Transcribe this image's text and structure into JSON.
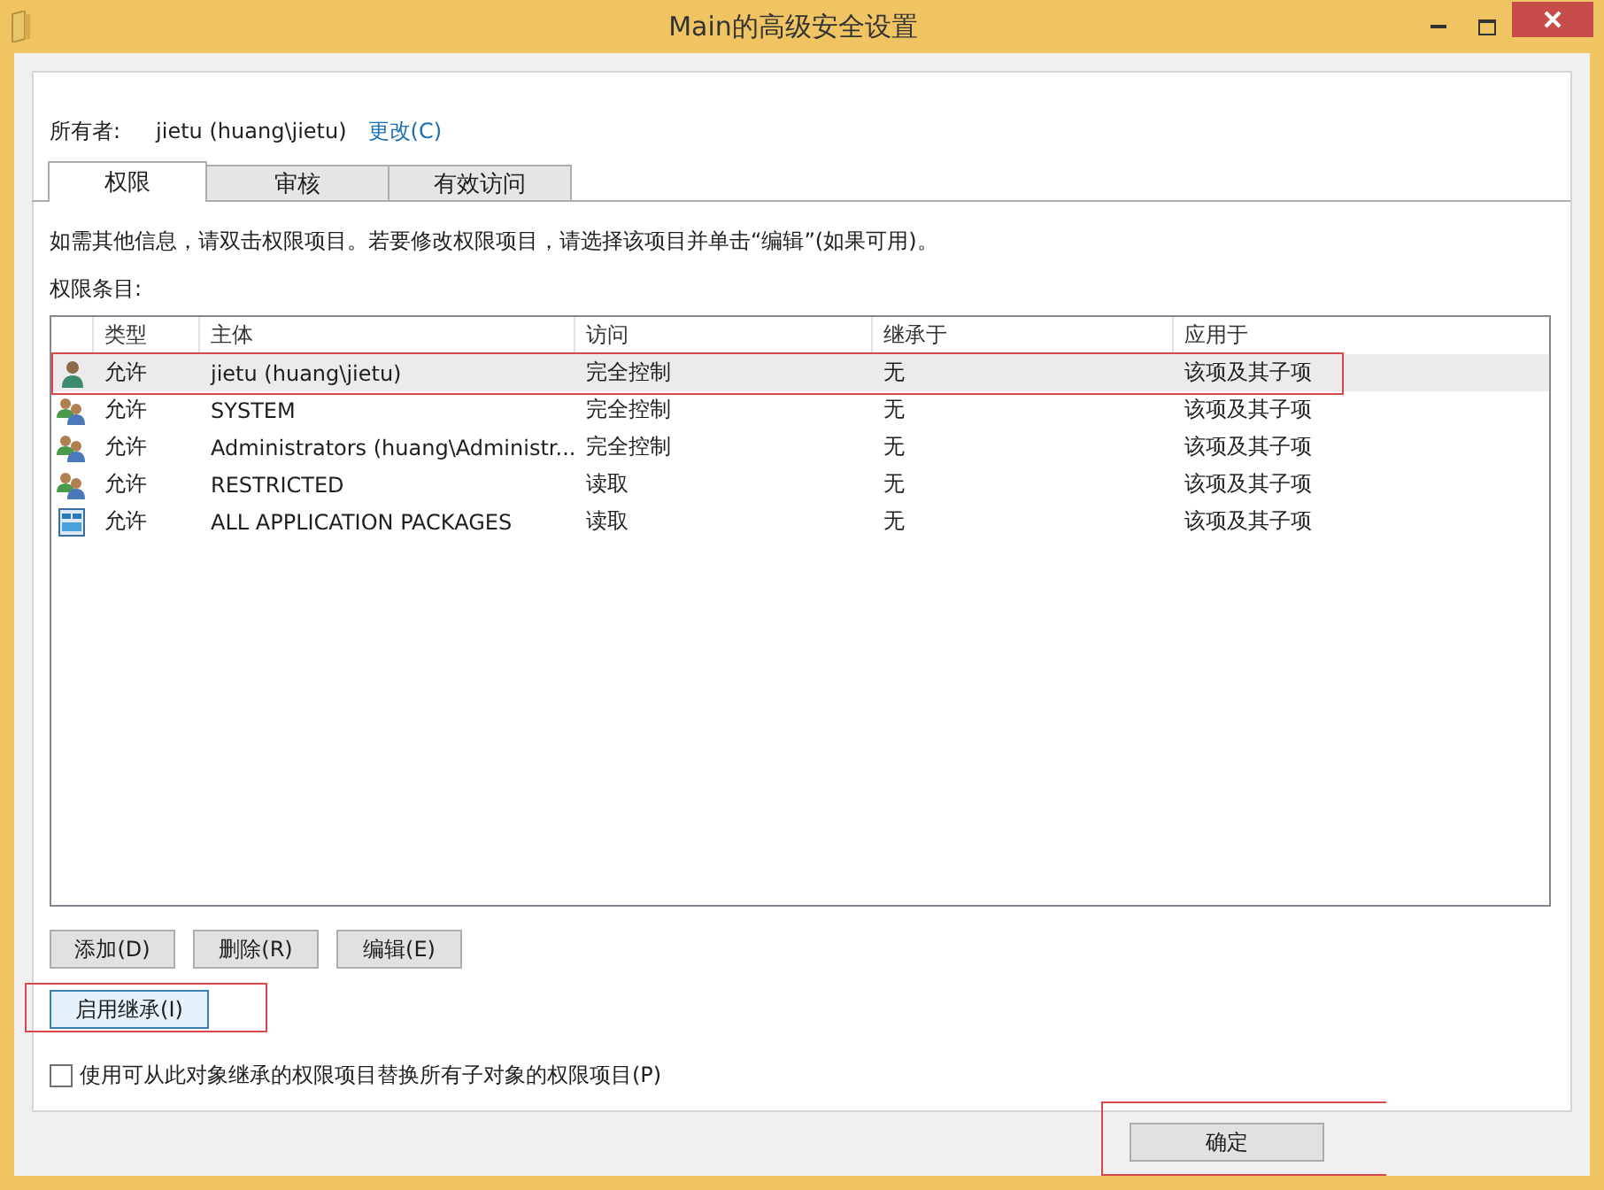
{
  "window": {
    "title": "Main的高级安全设置"
  },
  "owner": {
    "label": "所有者:",
    "value": "jietu (huang\\jietu)",
    "link": "更改(C)"
  },
  "tabs": [
    {
      "label": "权限",
      "selected": true
    },
    {
      "label": "审核",
      "selected": false
    },
    {
      "label": "有效访问",
      "selected": false
    }
  ],
  "info": "如需其他信息，请双击权限项目。若要修改权限项目，请选择该项目并单击“编辑”(如果可用)。",
  "list_label": "权限条目:",
  "table": {
    "columns": [
      "类型",
      "主体",
      "访问",
      "继承于",
      "应用于"
    ],
    "rows": [
      {
        "kind": "user",
        "selected": true,
        "highlighted": true,
        "cells": [
          "允许",
          "jietu (huang\\jietu)",
          "完全控制",
          "无",
          "该项及其子项"
        ]
      },
      {
        "kind": "group",
        "selected": false,
        "highlighted": false,
        "cells": [
          "允许",
          "SYSTEM",
          "完全控制",
          "无",
          "该项及其子项"
        ]
      },
      {
        "kind": "group",
        "selected": false,
        "highlighted": false,
        "cells": [
          "允许",
          "Administrators (huang\\Administr...",
          "完全控制",
          "无",
          "该项及其子项"
        ]
      },
      {
        "kind": "group",
        "selected": false,
        "highlighted": false,
        "cells": [
          "允许",
          "RESTRICTED",
          "读取",
          "无",
          "该项及其子项"
        ]
      },
      {
        "kind": "package",
        "selected": false,
        "highlighted": false,
        "cells": [
          "允许",
          "ALL APPLICATION PACKAGES",
          "读取",
          "无",
          "该项及其子项"
        ]
      }
    ]
  },
  "row_buttons": [
    "添加(D)",
    "删除(R)",
    "编辑(E)"
  ],
  "inherit_button": {
    "label": "启用继承(I)",
    "highlighted": true
  },
  "replace_checkbox": {
    "label": "使用可从此对象继承的权限项目替换所有子对象的权限项目(P)",
    "checked": false
  },
  "ok_button": {
    "label": "确定",
    "highlighted": true
  }
}
